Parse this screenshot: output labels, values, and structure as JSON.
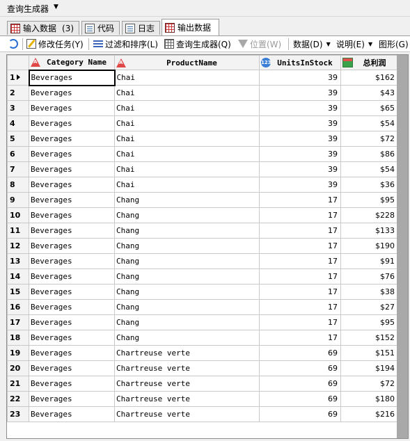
{
  "window": {
    "title": "查询生成器"
  },
  "tabs": [
    {
      "label": "输入数据",
      "count": "(3)"
    },
    {
      "label": "代码"
    },
    {
      "label": "日志"
    },
    {
      "label": "输出数据"
    }
  ],
  "toolbar": {
    "modify_task": "修改任务(Y)",
    "filter_sort": "过滤和排序(L)",
    "query_builder": "查询生成器(Q)",
    "position": "位置(W)",
    "data_menu": "数据(D)",
    "describe_menu": "说明(E)",
    "graph_menu": "图形(G)"
  },
  "grid": {
    "columns": [
      "Category Name",
      "ProductName",
      "UnitsInStock",
      "总利润"
    ],
    "rows": [
      [
        "1",
        "Beverages",
        "Chai",
        "39",
        "$162"
      ],
      [
        "2",
        "Beverages",
        "Chai",
        "39",
        "$43"
      ],
      [
        "3",
        "Beverages",
        "Chai",
        "39",
        "$65"
      ],
      [
        "4",
        "Beverages",
        "Chai",
        "39",
        "$54"
      ],
      [
        "5",
        "Beverages",
        "Chai",
        "39",
        "$72"
      ],
      [
        "6",
        "Beverages",
        "Chai",
        "39",
        "$86"
      ],
      [
        "7",
        "Beverages",
        "Chai",
        "39",
        "$54"
      ],
      [
        "8",
        "Beverages",
        "Chai",
        "39",
        "$36"
      ],
      [
        "9",
        "Beverages",
        "Chang",
        "17",
        "$95"
      ],
      [
        "10",
        "Beverages",
        "Chang",
        "17",
        "$228"
      ],
      [
        "11",
        "Beverages",
        "Chang",
        "17",
        "$133"
      ],
      [
        "12",
        "Beverages",
        "Chang",
        "17",
        "$190"
      ],
      [
        "13",
        "Beverages",
        "Chang",
        "17",
        "$91"
      ],
      [
        "14",
        "Beverages",
        "Chang",
        "17",
        "$76"
      ],
      [
        "15",
        "Beverages",
        "Chang",
        "17",
        "$38"
      ],
      [
        "16",
        "Beverages",
        "Chang",
        "17",
        "$27"
      ],
      [
        "17",
        "Beverages",
        "Chang",
        "17",
        "$95"
      ],
      [
        "18",
        "Beverages",
        "Chang",
        "17",
        "$152"
      ],
      [
        "19",
        "Beverages",
        "Chartreuse verte",
        "69",
        "$151"
      ],
      [
        "20",
        "Beverages",
        "Chartreuse verte",
        "69",
        "$194"
      ],
      [
        "21",
        "Beverages",
        "Chartreuse verte",
        "69",
        "$72"
      ],
      [
        "22",
        "Beverages",
        "Chartreuse verte",
        "69",
        "$180"
      ],
      [
        "23",
        "Beverages",
        "Chartreuse verte",
        "69",
        "$216"
      ]
    ]
  }
}
